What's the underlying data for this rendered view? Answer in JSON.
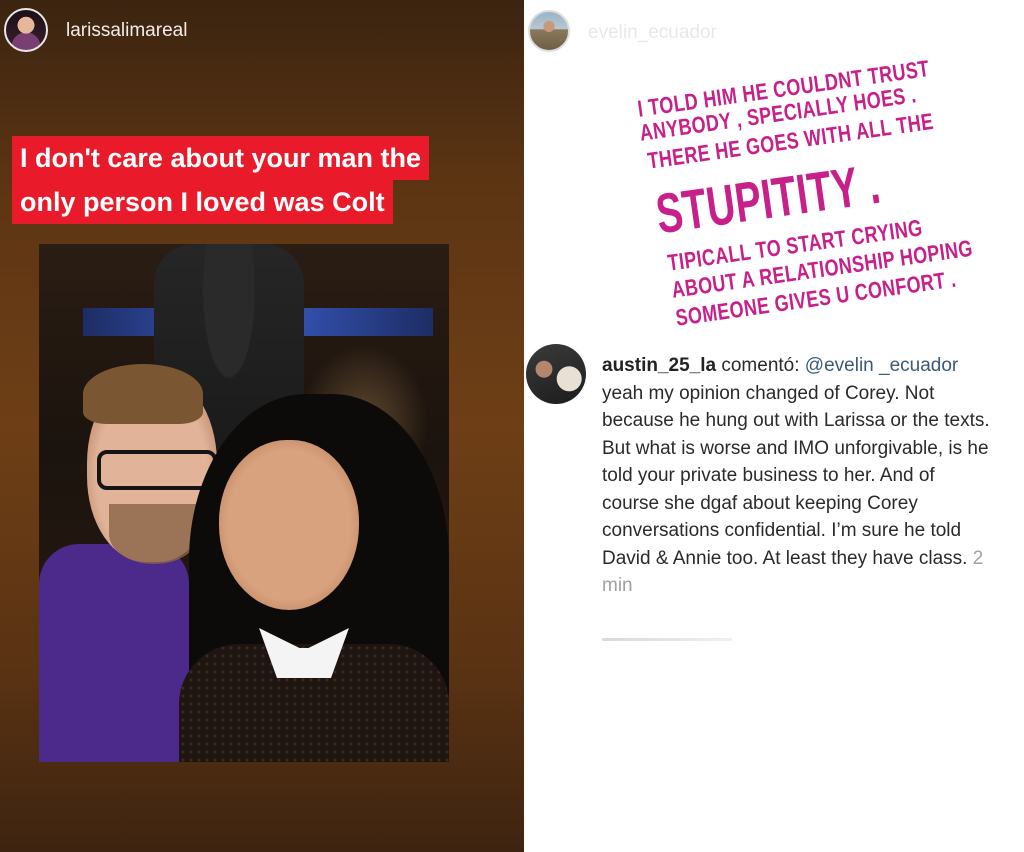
{
  "left_story": {
    "username": "larissalimareal",
    "caption_line1": "I don't care about your man the",
    "caption_line2": "only person I loved was Colt"
  },
  "right_story": {
    "username": "evelin_ecuador",
    "quote_lines": [
      "I TOLD HIM HE COULDNT TRUST",
      "ANYBODY , SPECIALLY HOES .",
      "THERE HE GOES WITH ALL THE",
      "STUPITITY .",
      "TIPICALL TO START CRYING",
      "ABOUT A RELATIONSHIP HOPING",
      "SOMEONE GIVES U CONFORT ."
    ],
    "quote_color": "#c8208a",
    "comment": {
      "username": "austin_25_la",
      "verb": "comentó:",
      "mention": "@evelin _ecuador",
      "body": "yeah my opinion changed of Corey. Not because he hung out with Larissa or the texts. But what is worse and IMO unforgivable, is he told your private business to her. And of course she dgaf about keeping Corey conversations confidential. I’m sure he told David & Annie too. At least they have class.",
      "time": "2 min"
    }
  },
  "colors": {
    "caption_bg": "#e91b2b"
  }
}
